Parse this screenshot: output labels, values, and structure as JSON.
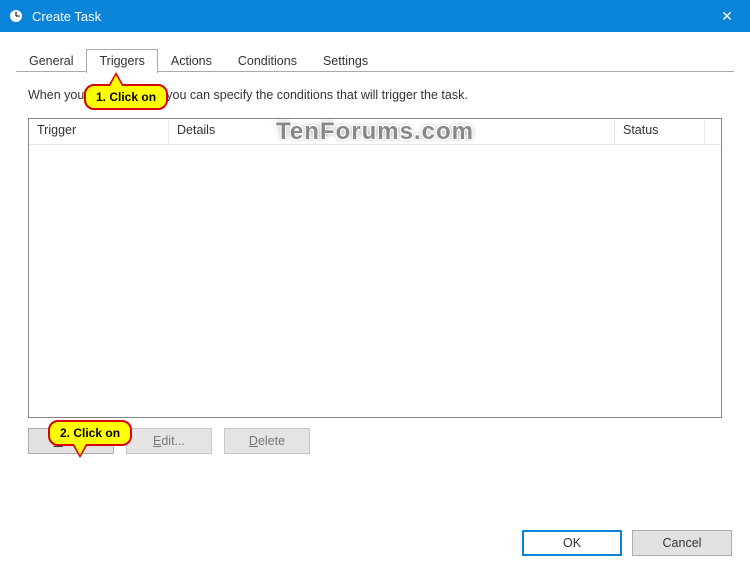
{
  "window": {
    "title": "Create Task",
    "close_glyph": "✕"
  },
  "tabs": {
    "general": "General",
    "triggers": "Triggers",
    "actions": "Actions",
    "conditions": "Conditions",
    "settings": "Settings",
    "active": "triggers"
  },
  "triggers_page": {
    "description": "When you create a task, you can specify the conditions that will trigger the task.",
    "columns": {
      "trigger": "Trigger",
      "details": "Details",
      "status": "Status"
    },
    "buttons": {
      "new": "New...",
      "edit": "Edit...",
      "delete": "Delete"
    }
  },
  "footer": {
    "ok": "OK",
    "cancel": "Cancel"
  },
  "annotations": {
    "callout1": "1. Click on",
    "callout2": "2. Click on"
  },
  "watermark": "TenForums.com"
}
